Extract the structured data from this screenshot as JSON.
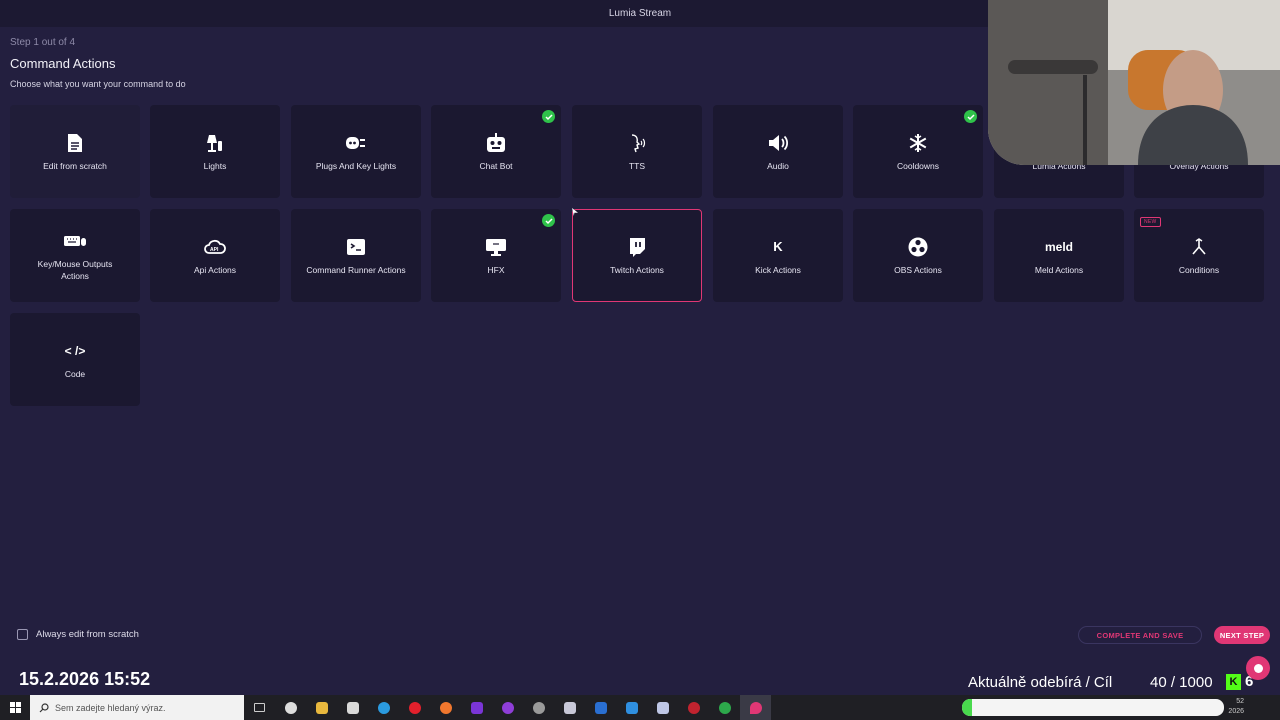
{
  "window": {
    "title": "Lumia Stream",
    "minimize_label": "—",
    "close_label": "✕"
  },
  "page": {
    "step": "Step 1 out of 4",
    "title": "Command Actions",
    "subtitle": "Choose what you want your command to do"
  },
  "cards": [
    {
      "label": "Edit from scratch",
      "icon": "file-icon"
    },
    {
      "label": "Lights",
      "icon": "lamp-icon"
    },
    {
      "label": "Plugs And Key Lights",
      "icon": "plug-icon"
    },
    {
      "label": "Chat Bot",
      "icon": "robot-icon",
      "checked": true
    },
    {
      "label": "TTS",
      "icon": "speaking-head-icon"
    },
    {
      "label": "Audio",
      "icon": "speaker-icon"
    },
    {
      "label": "Cooldowns",
      "icon": "snowflake-icon",
      "checked": true
    },
    {
      "label": "Lumia Actions",
      "icon": "lumia-icon"
    },
    {
      "label": "Overlay Actions",
      "icon": "overlay-icon"
    },
    {
      "label": "Key/Mouse Outputs Actions",
      "icon": "keyboard-icon"
    },
    {
      "label": "Api Actions",
      "icon": "api-cloud-icon"
    },
    {
      "label": "Command Runner Actions",
      "icon": "terminal-icon"
    },
    {
      "label": "HFX",
      "icon": "monitor-icon",
      "checked": true
    },
    {
      "label": "Twitch Actions",
      "icon": "twitch-icon",
      "selected": true
    },
    {
      "label": "Kick Actions",
      "icon": "kick-icon",
      "icon_text": "K"
    },
    {
      "label": "OBS Actions",
      "icon": "obs-icon"
    },
    {
      "label": "Meld Actions",
      "icon": "meld-icon",
      "icon_text": "meld"
    },
    {
      "label": "Conditions",
      "icon": "branch-icon",
      "badge": "NEW"
    },
    {
      "label": "Code",
      "icon": "code-icon",
      "icon_text": "< />"
    }
  ],
  "footer": {
    "always_edit_label": "Always edit from scratch",
    "always_edit_checked": false,
    "complete_save_label": "COMPLETE AND SAVE",
    "next_step_label": "NEXT STEP"
  },
  "stream_overlay": {
    "datetime": "15.2.2026 15:52",
    "subs_label": "Aktuálně odebírá / Cíl",
    "subs_progress": "40 / 1000",
    "kick_badge": "K",
    "kick_count": "6"
  },
  "taskbar": {
    "search_placeholder": "Sem zadejte hledaný výraz.",
    "clock_time": "52",
    "clock_date": "2026",
    "progress_fraction": 0.04,
    "apps": [
      "task-view",
      "clock-app",
      "file-explorer",
      "store",
      "edge",
      "opera",
      "firefox",
      "app-purple",
      "app-purple-2",
      "app-gear",
      "app-bird",
      "app-blue",
      "app-mail",
      "app-save",
      "app-red",
      "app-green",
      "lumia-app"
    ]
  },
  "colors": {
    "accent": "#e03775",
    "background": "#231f3f",
    "card": "#1b1830",
    "check": "#2fc24a"
  }
}
